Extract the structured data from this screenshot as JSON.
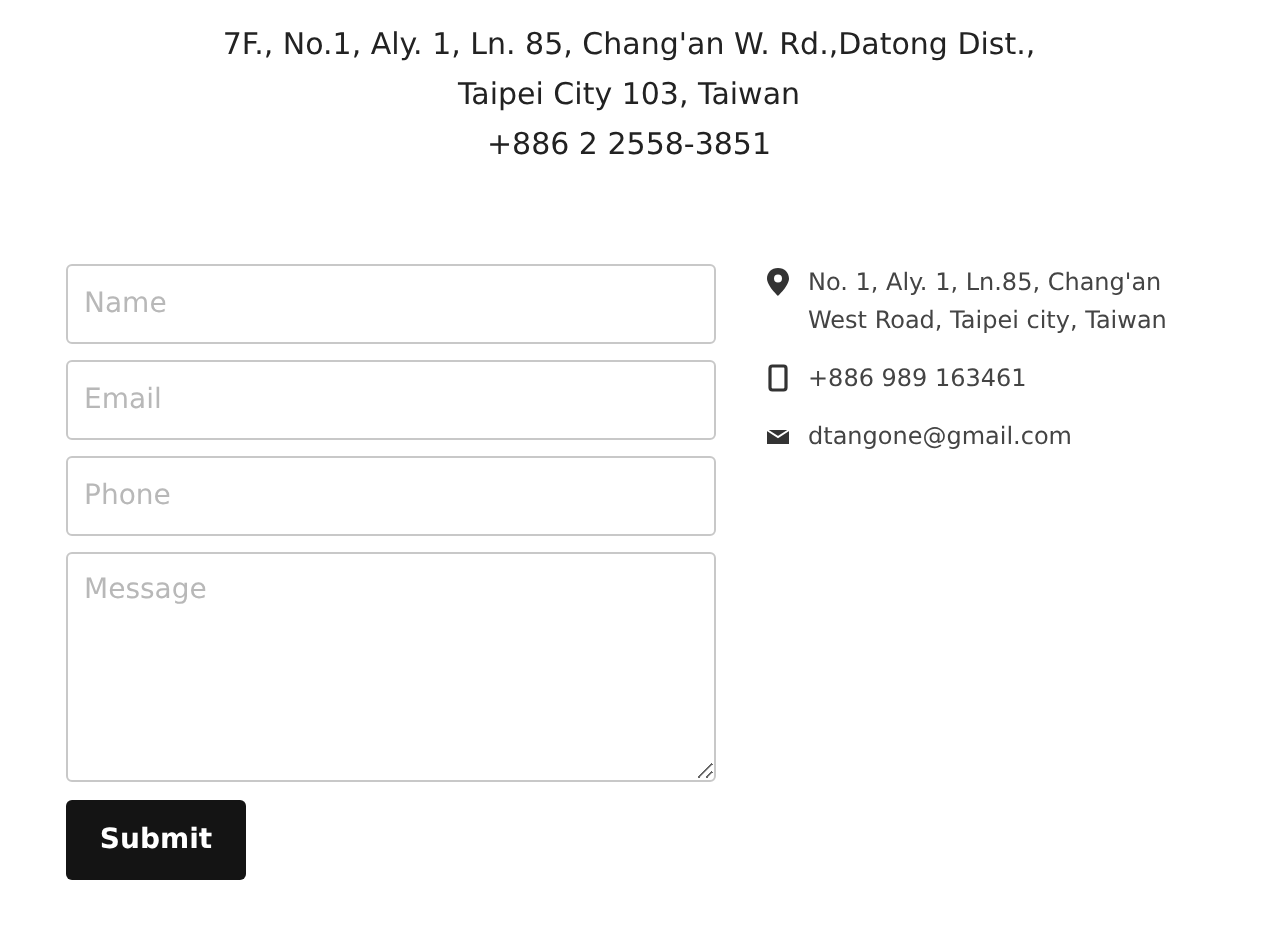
{
  "address_lines": [
    "7F., No.1, Aly. 1, Ln. 85, Chang'an W. Rd.,Datong Dist.,",
    "Taipei City 103, Taiwan",
    "+886 2 2558-3851"
  ],
  "form": {
    "fields": [
      {
        "kind": "input",
        "placeholder": "Name"
      },
      {
        "kind": "input",
        "placeholder": "Email"
      },
      {
        "kind": "input",
        "placeholder": "Phone"
      },
      {
        "kind": "textarea",
        "placeholder": "Message"
      }
    ],
    "submit": "Submit"
  },
  "contact": [
    {
      "kind": "location",
      "text": "No. 1, Aly. 1, Ln.85, Chang'an West Road, Taipei city, Taiwan"
    },
    {
      "kind": "phone",
      "text": "+886 989 163461"
    },
    {
      "kind": "email",
      "text": "dtangone@gmail.com"
    }
  ]
}
